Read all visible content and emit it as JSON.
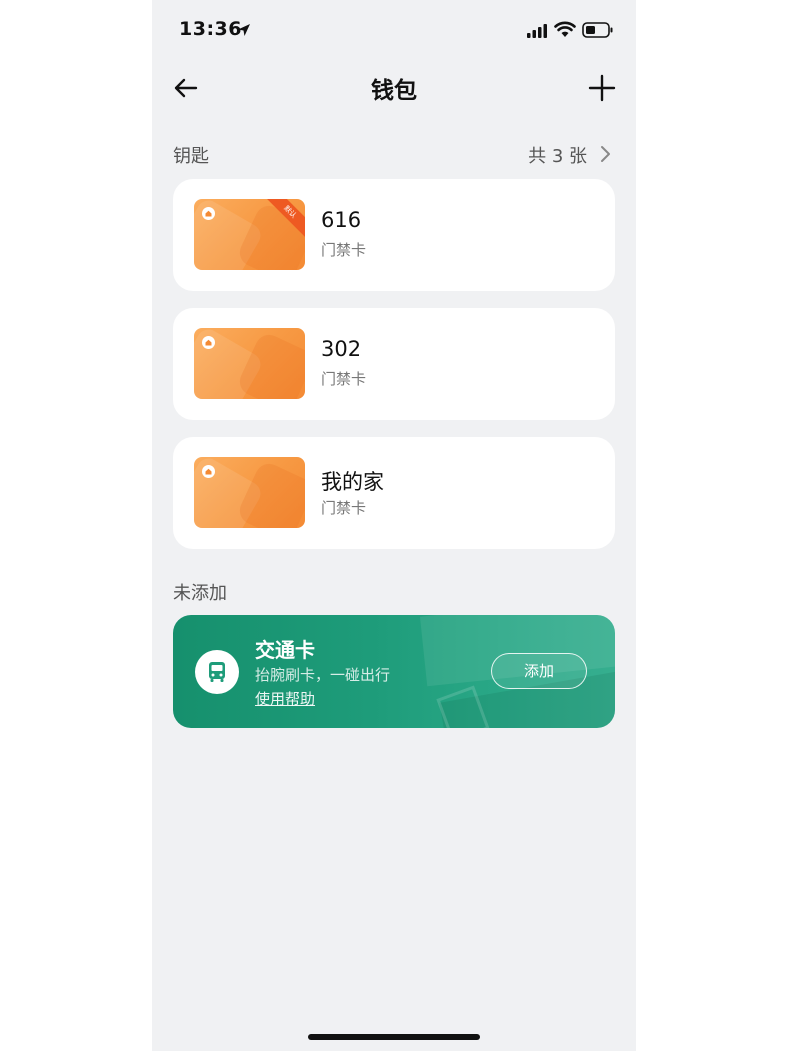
{
  "status_bar": {
    "time": "13:36",
    "location_icon": "location-arrow-icon",
    "signal_icon": "cellular-signal-icon",
    "wifi_icon": "wifi-icon",
    "battery_icon": "battery-icon"
  },
  "header": {
    "title": "钱包",
    "back_icon": "arrow-left-icon",
    "add_icon": "plus-icon"
  },
  "keys_section": {
    "title": "钥匙",
    "count": "共 3 张",
    "chevron_icon": "chevron-right-icon"
  },
  "keys": [
    {
      "name": "616",
      "type": "门禁卡",
      "badge": "默认",
      "color": "#f79a44"
    },
    {
      "name": "302",
      "type": "门禁卡",
      "color": "#f79a44"
    },
    {
      "name": "我的家",
      "type": "门禁卡",
      "color": "#f79a44"
    }
  ],
  "not_added_section": {
    "title": "未添加"
  },
  "transit_card": {
    "title": "交通卡",
    "subtitle": "抬腕刷卡，一碰出行",
    "help_link": "使用帮助",
    "add_button": "添加",
    "icon": "bus-icon",
    "color": "#1e9c7a"
  }
}
